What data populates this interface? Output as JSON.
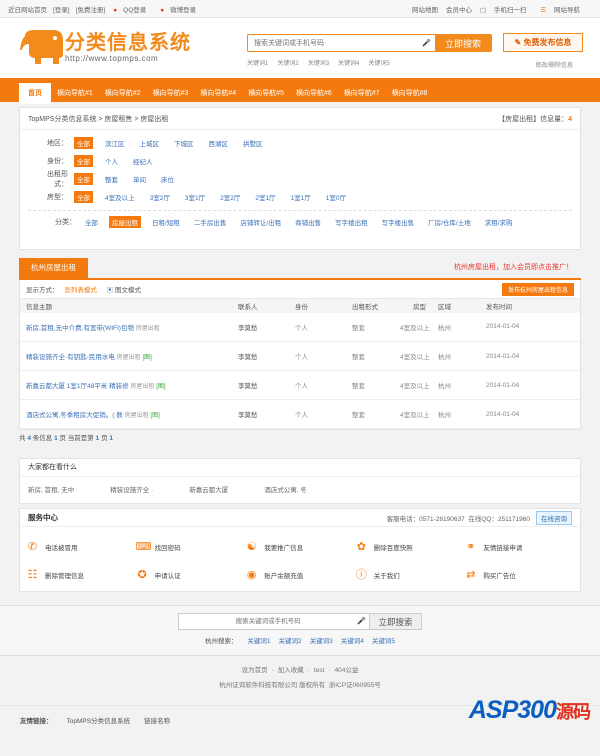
{
  "topbar": {
    "left": [
      "近日网站首页",
      "[登录]",
      "[免费注册]"
    ],
    "qq": "QQ登录",
    "weibo": "微博登录",
    "right": [
      "网站地图",
      "会员中心",
      "手机扫一扫",
      "网站导航"
    ]
  },
  "logo": {
    "text": "分类信息系统",
    "url": "http://www.topmps.com"
  },
  "search": {
    "placeholder": "搜索关键词或手机号码",
    "button": "立即搜索",
    "hot": [
      "关键词1",
      "关键词2",
      "关键词3",
      "关键词4",
      "关键词5"
    ]
  },
  "publish": "免费发布信息",
  "modify": "修改/删除信息",
  "nav": [
    "首页",
    "横向导航#1",
    "横向导航#2",
    "横向导航#3",
    "横向导航#4",
    "横向导航#5",
    "横向导航#6",
    "横向导航#7",
    "横向导航#8"
  ],
  "crumb": {
    "path": "TopMPS分类信息系统 > 房屋租售 > 房屋出租",
    "count_label": "【房屋出租】信息量：",
    "count": "4"
  },
  "filters": [
    {
      "label": "地区：",
      "items": [
        "全部",
        "滨江区",
        "上城区",
        "下城区",
        "西湖区",
        "拱墅区"
      ]
    },
    {
      "label": "身份：",
      "items": [
        "全部",
        "个人",
        "经纪人"
      ]
    },
    {
      "label": "出租形式：",
      "items": [
        "全部",
        "整套",
        "单间",
        "床位"
      ]
    },
    {
      "label": "房型：",
      "items": [
        "全部",
        "4室及以上",
        "3室2厅",
        "3室1厅",
        "2室2厅",
        "2室1厅",
        "1室1厅",
        "1室0厅"
      ]
    }
  ],
  "categories": {
    "label": "分类：",
    "items": [
      "全部",
      "房屋出租",
      "日租/短租",
      "二手房出售",
      "店铺转让/出租",
      "商铺出售",
      "写字楼出租",
      "写字楼出售",
      "厂房/仓库/土地",
      "求租/求购"
    ]
  },
  "list": {
    "tab": "杭州房屋出租",
    "promo": "杭州房屋出租，加入会员即点击推广！",
    "mode_label": "显示方式：",
    "mode_list": "列表模式",
    "mode_pic": "图文模式",
    "publish_btn": "发布杭州房屋出租信息",
    "headers": [
      "信息主题",
      "联系人",
      "身份",
      "出租形式",
      "房型",
      "区域",
      "发布时间"
    ],
    "rows": [
      {
        "title": "新房,首租,无中介费,有宽带(WIFI)包物",
        "tag": "房屋出租",
        "pic": "",
        "contact": "李莫愁",
        "identity": "个人",
        "form": "整套",
        "room": "4室及以上",
        "area": "杭州",
        "date": "2014-01-04"
      },
      {
        "title": "精装设施齐全·有钥匙·民用水电",
        "tag": "房屋出租",
        "pic": "[图]",
        "contact": "李莫愁",
        "identity": "个人",
        "form": "整套",
        "room": "4室及以上",
        "area": "杭州",
        "date": "2014-01-04"
      },
      {
        "title": "新嘉云都大厦 1室1厅48平米 精装修",
        "tag": "房屋出租",
        "pic": "[图]",
        "contact": "李莫愁",
        "identity": "个人",
        "form": "整套",
        "room": "4室及以上",
        "area": "杭州",
        "date": "2014-01-04"
      },
      {
        "title": "酒店式公寓,冬季租房大促销。( 数",
        "tag": "房屋出租",
        "pic": "[图]",
        "contact": "李莫愁",
        "identity": "个人",
        "form": "整套",
        "room": "4室及以上",
        "area": "杭州",
        "date": "2014-01-04"
      }
    ],
    "pager": {
      "p1": "共",
      "total": "4",
      "p2": "条信息",
      "pages": "1",
      "p3": "页 当前是第",
      "current": "1",
      "p4": "页",
      "page": "1"
    }
  },
  "watching": {
    "title": "大家都在看什么",
    "items": [
      "新房, 首租, 无中",
      "精装设施齐全 ·",
      "新嘉云都大厦",
      "酒店式公寓, 冬"
    ]
  },
  "service": {
    "title": "服务中心",
    "phone": "客服电话：0571-28190637",
    "qq": "在线QQ：251171960",
    "online": "在线咨询",
    "items": [
      "电话被冒用",
      "找回密码",
      "我要推广信息",
      "删除百度快照",
      "友情链接申请",
      "删除管理信息",
      "申请认证",
      "账户余额充值",
      "关于我们",
      "购买广告位"
    ]
  },
  "bottom_search": {
    "placeholder": "搜索关键词或手机号码",
    "button": "立即搜索",
    "label": "杭州搜索：",
    "hot": [
      "关键词1",
      "关键词2",
      "关键词3",
      "关键词4",
      "关键词5"
    ]
  },
  "footer": {
    "links": [
      "设为首页",
      "加入收藏",
      "test",
      "404公益"
    ],
    "copy": "杭州证询软件科技有限公司 版权所有",
    "icp": "浙ICP证060955号"
  },
  "friends": {
    "label": "友情链接：",
    "items": [
      "TopMPS分类信息系统",
      "链接名称"
    ]
  },
  "watermark": {
    "main": "ASP300",
    "sub": "源码"
  }
}
